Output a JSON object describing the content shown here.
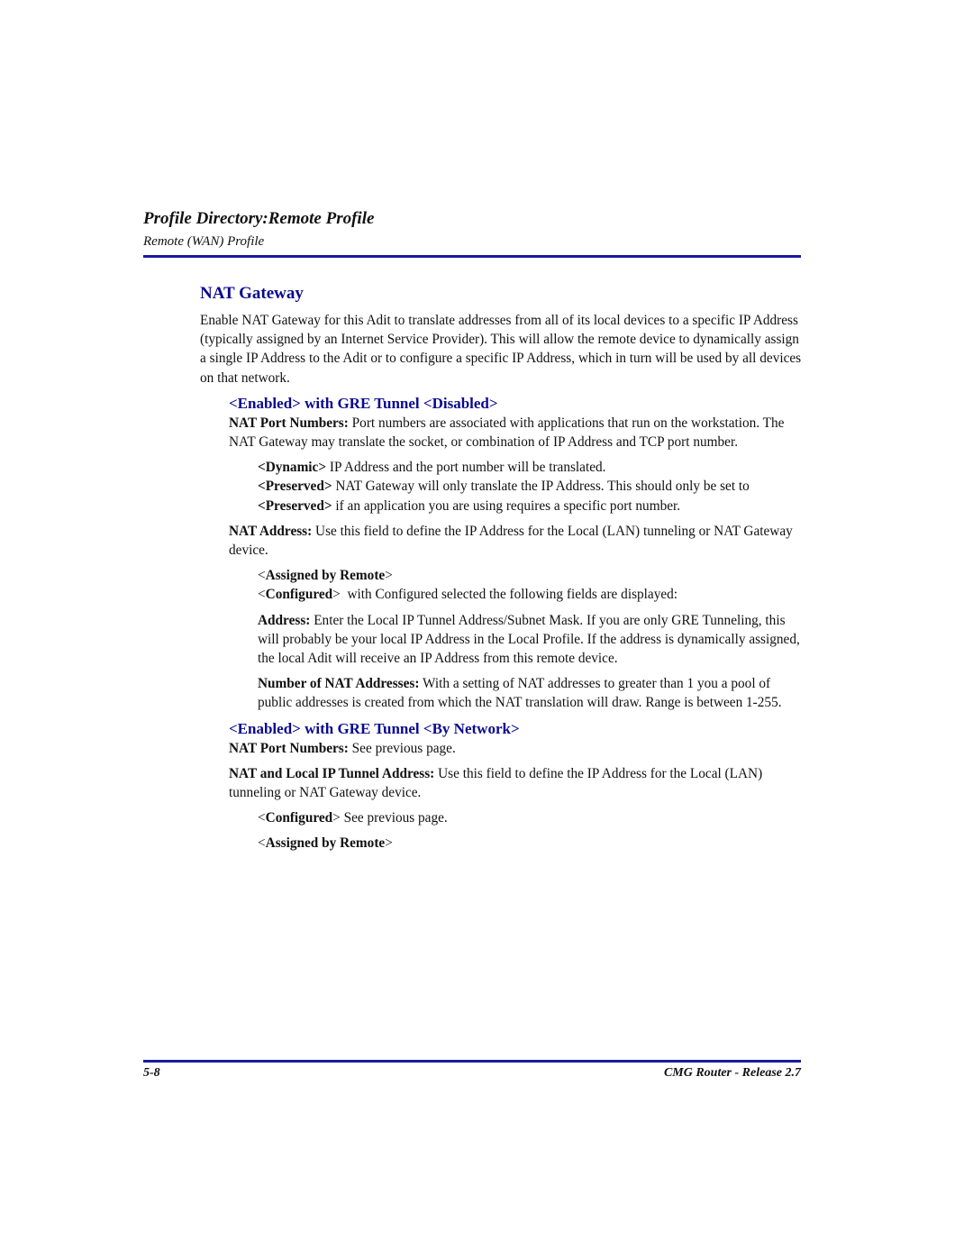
{
  "header": {
    "title": "Profile Directory:Remote Profile",
    "subtitle": "Remote (WAN) Profile"
  },
  "colors": {
    "accent_blue": "#0a0a8f",
    "rule_blue": "#1a1a9c"
  },
  "section": {
    "title": "NAT Gateway",
    "intro": "Enable NAT Gateway for this Adit to translate addresses from all of its local devices to a specific IP Address (typically assigned by an Internet Service Provider). This will allow the remote device to dynamically assign a single IP Address to the Adit or to configure a specific IP Address, which in turn will be used by all devices on that network."
  },
  "sub1": {
    "title": "<Enabled> with GRE Tunnel <Disabled>",
    "port_numbers_label": "NAT Port Numbers:",
    "port_numbers_text": " Port numbers are associated with applications that run on the workstation. The NAT Gateway may translate the socket, or combination of IP Address and TCP port number.",
    "dynamic_label": "<Dynamic>",
    "dynamic_text": " IP Address and the port number will be translated.",
    "preserved_label": "<Preserved>",
    "preserved_text1": " NAT Gateway will only translate the IP Address. This should only be set to ",
    "preserved_label2": "<Preserved>",
    "preserved_text2": " if an application you are using requires a specific port number.",
    "nat_address_label": "NAT Address:",
    "nat_address_text": " Use this field to define the IP Address for the Local (LAN) tunneling or NAT Gateway device.",
    "assigned_open": "<",
    "assigned_label": "Assigned by Remote",
    "assigned_close": ">",
    "configured_open": "<",
    "configured_label": "Configured",
    "configured_close": ">",
    "configured_text": "  with Configured selected the following fields are displayed:",
    "address_label": "Address:",
    "address_text": " Enter the Local IP Tunnel Address/Subnet Mask. If you are only GRE Tunneling, this will probably be your local IP Address in the Local Profile. If the address is dynamically assigned, the local Adit will receive an IP Address from this remote device.",
    "num_nat_label": "Number of NAT Addresses:",
    "num_nat_text": " With a setting of NAT addresses to greater than 1 you a pool of public addresses is created from which the NAT translation will draw. Range is between 1-255."
  },
  "sub2": {
    "title": "<Enabled> with GRE Tunnel <By Network>",
    "port_numbers_label": "NAT Port Numbers:",
    "port_numbers_text": " See previous page.",
    "local_tunnel_label": "NAT and Local IP Tunnel Address:",
    "local_tunnel_text": " Use this field to define the IP Address for the Local (LAN) tunneling or NAT Gateway device.",
    "configured_open": "<",
    "configured_label": "Configured",
    "configured_close": ">",
    "configured_text": " See previous page.",
    "assigned_open": "<",
    "assigned_label": "Assigned by Remote",
    "assigned_close": ">"
  },
  "footer": {
    "page_number": "5-8",
    "product": "CMG Router - Release 2.7"
  }
}
